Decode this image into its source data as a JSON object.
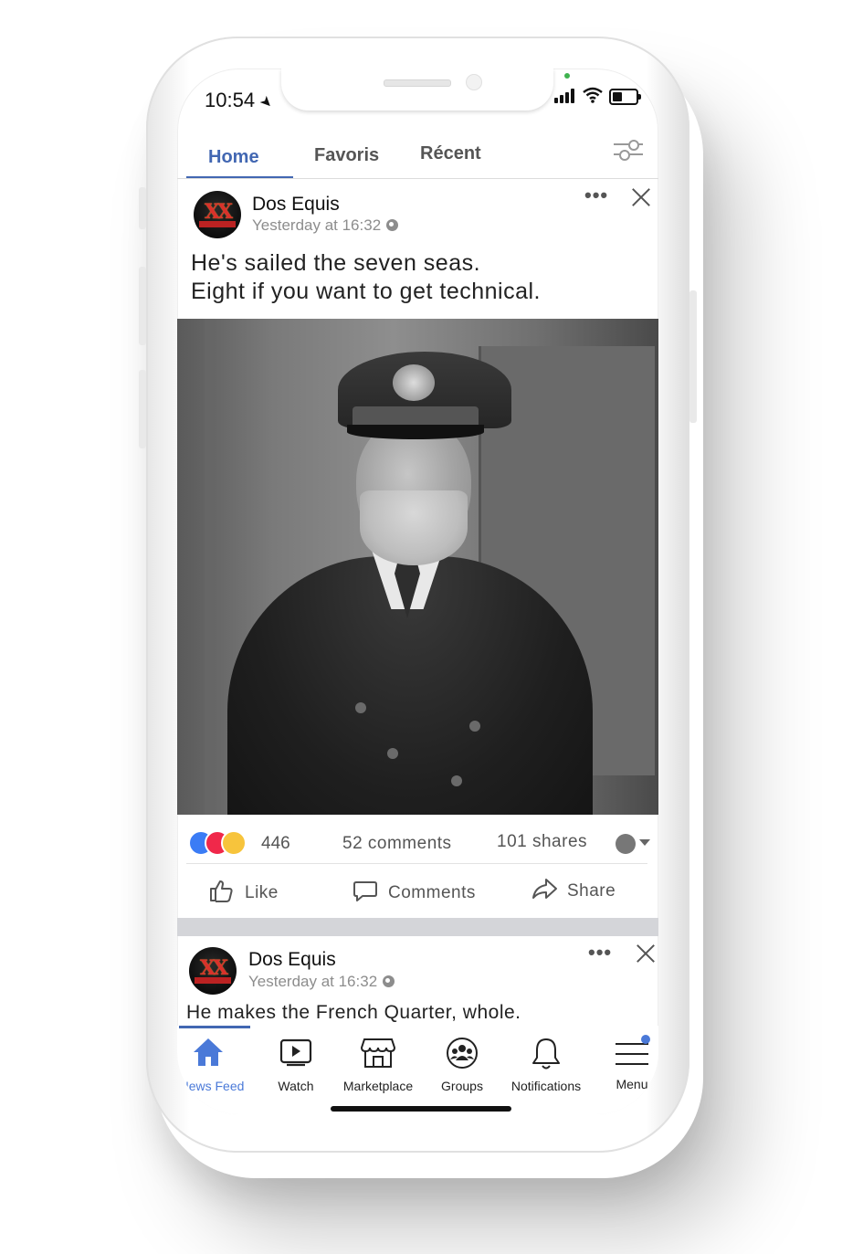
{
  "status_bar": {
    "time": "10:54"
  },
  "tabs": [
    {
      "label": "Home",
      "active": true
    },
    {
      "label": "Favoris",
      "active": false
    },
    {
      "label": "Récent",
      "active": false
    }
  ],
  "posts": [
    {
      "page_name": "Dos Equis",
      "time": "Yesterday at 16:32",
      "text_lines": [
        "He's sailed the seven seas.",
        "Eight if you want to get technical."
      ],
      "reactions_count": "446",
      "comments_count": "52 comments",
      "shares_count": "101 shares",
      "actions": {
        "like": "Like",
        "comment": "Comments",
        "share": "Share"
      }
    },
    {
      "page_name": "Dos Equis",
      "time": "Yesterday at 16:32",
      "text": "He makes the French Quarter, whole."
    }
  ],
  "bottom_nav": [
    {
      "label": "News Feed",
      "icon": "home-icon",
      "active": true
    },
    {
      "label": "Watch",
      "icon": "watch-icon",
      "active": false
    },
    {
      "label": "Marketplace",
      "icon": "marketplace-icon",
      "active": false
    },
    {
      "label": "Groups",
      "icon": "groups-icon",
      "active": false
    },
    {
      "label": "Notifications",
      "icon": "bell-icon",
      "active": false
    },
    {
      "label": "Menu",
      "icon": "menu-icon",
      "active": false,
      "badge": true
    }
  ],
  "colors": {
    "accent": "#4267b2",
    "nav_active": "#4a79d8",
    "like_blue": "#3b7cf5",
    "love_red": "#f0284a",
    "haha_yellow": "#f7c43c"
  }
}
